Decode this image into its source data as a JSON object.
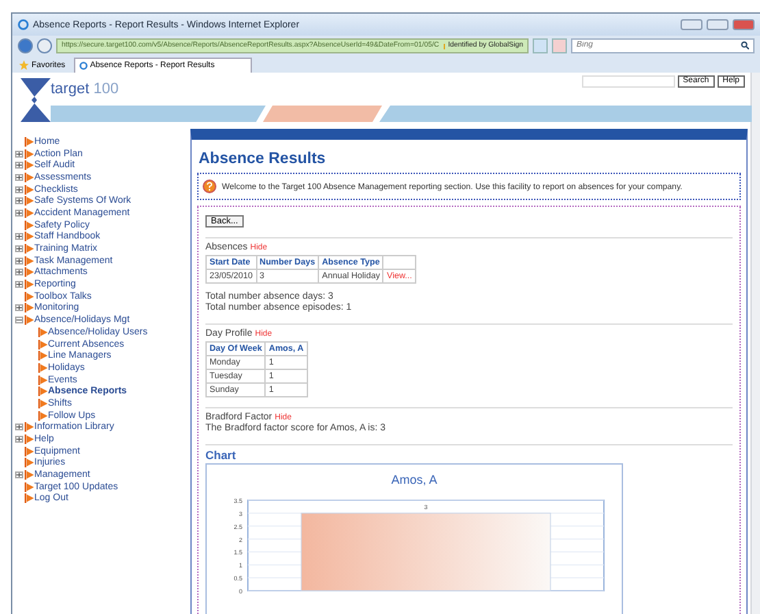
{
  "window": {
    "title": "Absence Reports - Report Results - Windows Internet Explorer"
  },
  "address_bar": {
    "url": "https://secure.target100.com/v5/Absence/Reports/AbsenceReportResults.aspx?AbsenceUserId=49&DateFrom=01/05/C",
    "identity": "Identified by GlobalSign",
    "search_placeholder": "Bing"
  },
  "favorites_bar": {
    "favorites": "Favorites",
    "tab": "Absence Reports - Report Results"
  },
  "header": {
    "logo": "target 100",
    "search_button": "Search",
    "help_button": "Help"
  },
  "nav": [
    {
      "label": "Home",
      "kind": "leaf",
      "selected": false
    },
    {
      "label": "Action Plan",
      "kind": "branch",
      "expanded": false,
      "selected": false
    },
    {
      "label": "Self Audit",
      "kind": "branch",
      "expanded": false,
      "selected": false
    },
    {
      "label": "Assessments",
      "kind": "branch",
      "expanded": false,
      "selected": false
    },
    {
      "label": "Checklists",
      "kind": "branch",
      "expanded": false,
      "selected": false
    },
    {
      "label": "Safe Systems Of Work",
      "kind": "branch",
      "expanded": false,
      "selected": false
    },
    {
      "label": "Accident Management",
      "kind": "branch",
      "expanded": false,
      "selected": false
    },
    {
      "label": "Safety Policy",
      "kind": "leaf",
      "selected": false
    },
    {
      "label": "Staff Handbook",
      "kind": "branch",
      "expanded": false,
      "selected": false
    },
    {
      "label": "Training Matrix",
      "kind": "branch",
      "expanded": false,
      "selected": false
    },
    {
      "label": "Task Management",
      "kind": "branch",
      "expanded": false,
      "selected": false
    },
    {
      "label": "Attachments",
      "kind": "branch",
      "expanded": false,
      "selected": false
    },
    {
      "label": "Reporting",
      "kind": "branch",
      "expanded": false,
      "selected": false
    },
    {
      "label": "Toolbox Talks",
      "kind": "leaf",
      "selected": false
    },
    {
      "label": "Monitoring",
      "kind": "branch",
      "expanded": false,
      "selected": false
    },
    {
      "label": "Absence/Holidays Mgt",
      "kind": "branch",
      "expanded": true,
      "selected": false,
      "children": [
        {
          "label": "Absence/Holiday Users",
          "selected": false
        },
        {
          "label": "Current Absences",
          "selected": false
        },
        {
          "label": "Line Managers",
          "selected": false
        },
        {
          "label": "Holidays",
          "selected": false
        },
        {
          "label": "Events",
          "selected": false
        },
        {
          "label": "Absence Reports",
          "selected": true
        },
        {
          "label": "Shifts",
          "selected": false
        },
        {
          "label": "Follow Ups",
          "selected": false
        }
      ]
    },
    {
      "label": "Information Library",
      "kind": "branch",
      "expanded": false,
      "selected": false
    },
    {
      "label": "Help",
      "kind": "branch",
      "expanded": false,
      "selected": false
    },
    {
      "label": "Equipment",
      "kind": "leaf",
      "selected": false
    },
    {
      "label": "Injuries",
      "kind": "leaf",
      "selected": false
    },
    {
      "label": "Management",
      "kind": "branch",
      "expanded": false,
      "selected": false
    },
    {
      "label": "Target 100 Updates",
      "kind": "leaf",
      "selected": false
    },
    {
      "label": "Log Out",
      "kind": "leaf",
      "selected": false
    }
  ],
  "content": {
    "title": "Absence Results",
    "info": "Welcome to the Target 100 Absence Management reporting section. Use this facility to report on absences for your company.",
    "back_button": "Back...",
    "absences": {
      "title": "Absences",
      "hide": "Hide",
      "columns": [
        "Start Date",
        "Number Days",
        "Absence Type"
      ],
      "rows": [
        {
          "cells": [
            "23/05/2010",
            "3",
            "Annual Holiday"
          ],
          "link": "View..."
        }
      ]
    },
    "totals": [
      "Total number absence days: 3",
      "Total number absence episodes: 1"
    ],
    "day_profile": {
      "title": "Day Profile",
      "hide": "Hide",
      "columns": [
        "Day Of Week",
        "Amos, A"
      ],
      "rows": [
        [
          "Monday",
          "1"
        ],
        [
          "Tuesday",
          "1"
        ],
        [
          "Sunday",
          "1"
        ]
      ]
    },
    "bradford": {
      "title": "Bradford Factor",
      "hide": "Hide",
      "text": "The Bradford factor score for Amos, A is: 3"
    },
    "chart_heading": "Chart",
    "chart": {
      "chart_data": {
        "type": "bar",
        "title": "Amos, A",
        "values": [
          3
        ],
        "ylim": [
          0,
          3.5
        ],
        "yticks": [
          0,
          0.5,
          1,
          1.5,
          2,
          2.5,
          3,
          3.5
        ],
        "data_labels": true,
        "grid": true
      }
    }
  }
}
